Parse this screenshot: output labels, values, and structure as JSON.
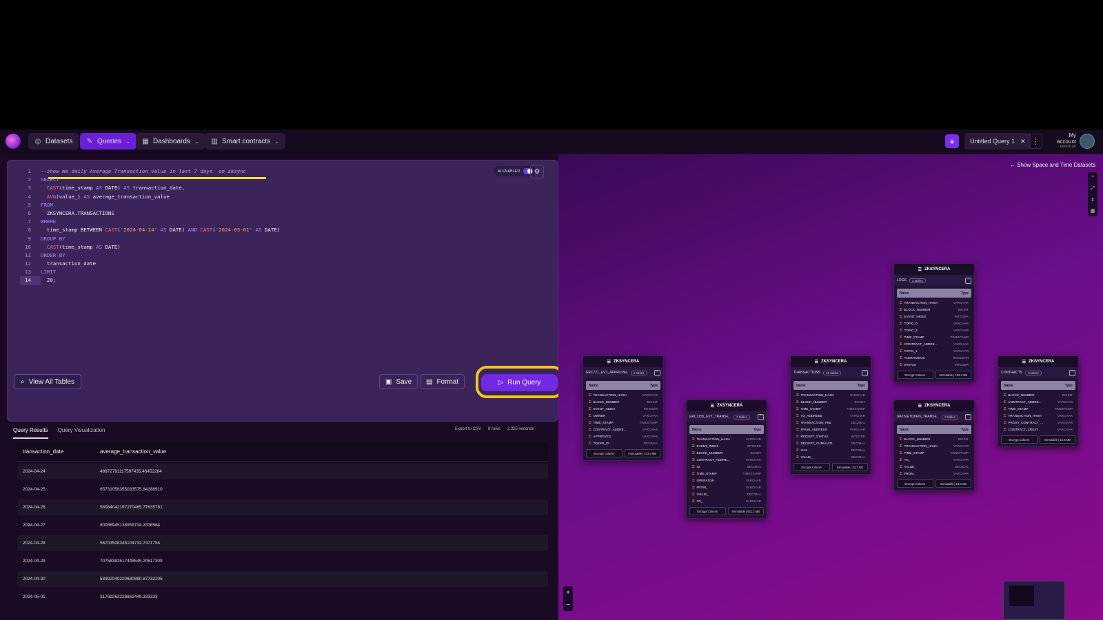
{
  "nav": {
    "datasets": "Datasets",
    "queries": "Queries",
    "dashboards": "Dashboards",
    "smart_contracts": "Smart contracts",
    "query_tab": "Untitled Query 1",
    "account_title": "My account",
    "account_sub": "qwertran"
  },
  "editor": {
    "ai_label": "AI ENABLED",
    "lines": [
      {
        "n": "1",
        "segs": [
          {
            "c": "cm",
            "t": "--show me daily Average Transaction Value in last 7 days  on zksync"
          }
        ]
      },
      {
        "n": "2",
        "segs": [
          {
            "c": "kw",
            "t": "SELECT"
          }
        ]
      },
      {
        "n": "3",
        "segs": [
          {
            "c": "tx",
            "t": "  "
          },
          {
            "c": "fn",
            "t": "CAST"
          },
          {
            "c": "tx",
            "t": "(time_stamp "
          },
          {
            "c": "kw",
            "t": "AS"
          },
          {
            "c": "tx",
            "t": " DATE) "
          },
          {
            "c": "kw",
            "t": "AS"
          },
          {
            "c": "tx",
            "t": " transaction_date,"
          }
        ]
      },
      {
        "n": "4",
        "segs": [
          {
            "c": "tx",
            "t": "  "
          },
          {
            "c": "fn",
            "t": "AVG"
          },
          {
            "c": "tx",
            "t": "(value_) "
          },
          {
            "c": "kw",
            "t": "AS"
          },
          {
            "c": "tx",
            "t": " average_transaction_value"
          }
        ]
      },
      {
        "n": "5",
        "segs": [
          {
            "c": "kw",
            "t": "FROM"
          }
        ]
      },
      {
        "n": "6",
        "segs": [
          {
            "c": "tx",
            "t": "  ZKSYNCERA.TRANSACTIONS"
          }
        ]
      },
      {
        "n": "7",
        "segs": [
          {
            "c": "kw",
            "t": "WHERE"
          }
        ]
      },
      {
        "n": "8",
        "segs": [
          {
            "c": "tx",
            "t": "  time_stamp BETWEEN "
          },
          {
            "c": "fn",
            "t": "CAST"
          },
          {
            "c": "tx",
            "t": "("
          },
          {
            "c": "str",
            "t": "'2024-04-24'"
          },
          {
            "c": "tx",
            "t": " "
          },
          {
            "c": "kw",
            "t": "AS"
          },
          {
            "c": "tx",
            "t": " DATE) "
          },
          {
            "c": "kw",
            "t": "AND"
          },
          {
            "c": "tx",
            "t": " "
          },
          {
            "c": "fn",
            "t": "CAST"
          },
          {
            "c": "tx",
            "t": "("
          },
          {
            "c": "str",
            "t": "'2024-05-01'"
          },
          {
            "c": "tx",
            "t": " "
          },
          {
            "c": "kw",
            "t": "AS"
          },
          {
            "c": "tx",
            "t": " DATE)"
          }
        ]
      },
      {
        "n": "9",
        "segs": [
          {
            "c": "kw",
            "t": "GROUP BY"
          }
        ]
      },
      {
        "n": "10",
        "segs": [
          {
            "c": "tx",
            "t": "  "
          },
          {
            "c": "fn",
            "t": "CAST"
          },
          {
            "c": "tx",
            "t": "(time_stamp "
          },
          {
            "c": "kw",
            "t": "AS"
          },
          {
            "c": "tx",
            "t": " DATE)"
          }
        ]
      },
      {
        "n": "11",
        "segs": [
          {
            "c": "kw",
            "t": "ORDER BY"
          }
        ]
      },
      {
        "n": "12",
        "segs": [
          {
            "c": "tx",
            "t": "  transaction_date"
          }
        ]
      },
      {
        "n": "13",
        "segs": [
          {
            "c": "kw",
            "t": "LIMIT"
          }
        ]
      },
      {
        "n": "14",
        "segs": [
          {
            "c": "tx",
            "t": "  20;"
          }
        ]
      }
    ],
    "view_all_tables": "View All Tables",
    "save": "Save",
    "format": "Format",
    "run_query": "Run Query"
  },
  "results": {
    "tab_results": "Query Results",
    "tab_viz": "Query Visualization",
    "export": "Export to CSV",
    "rows": "8 rows",
    "time": "2.325 seconds",
    "columns": [
      "transaction_date",
      "average_transaction_value"
    ],
    "rows_data": [
      [
        "2024-04-24",
        "48872791117597435.46452284"
      ],
      [
        "2024-04-25",
        "65731058355033575.84188910"
      ],
      [
        "2024-04-26",
        "58084042197270465.77635781"
      ],
      [
        "2024-04-27",
        "80086945138959734.2836564"
      ],
      [
        "2024-04-28",
        "56703508345104732.7471754"
      ],
      [
        "2024-04-29",
        "70758381517448545.20617309"
      ],
      [
        "2024-04-30",
        "58392040220680880.87732205"
      ],
      [
        "2024-05-01",
        "31769263228862449.333333"
      ]
    ]
  },
  "canvas": {
    "show_datasets": "Show Space and Time Datasets",
    "name_col": "Name",
    "type_col": "Type",
    "encrypt": "Encrypt Column",
    "tables": [
      {
        "db": "ZKSYNCERA",
        "name": "ERC721_EVT_APPROVAL",
        "count": "2 tables",
        "size": "Immutable | 273.3 MB",
        "cols": [
          [
            "TRANSACTION_HASH",
            "VARCHAR"
          ],
          [
            "BLOCK_NUMBER",
            "BIGINT"
          ],
          [
            "EVENT_INDEX",
            "INTEGER"
          ],
          [
            "OWNER",
            "VARCHAR"
          ],
          [
            "TIME_STAMP",
            "TIMESTAMP"
          ],
          [
            "CONTRACT_ADDRE...",
            "VARCHAR"
          ],
          [
            "APPROVED",
            "VARCHAR"
          ],
          [
            "TOKEN_ID",
            "DECIMAL"
          ]
        ]
      },
      {
        "db": "ZKSYNCERA",
        "name": "ERC1155_EVT_TRANSF...",
        "count": "2 tables",
        "size": "Immutable | 611.2 MB",
        "cols": [
          [
            "TRANSACTION_HASH",
            "VARCHAR"
          ],
          [
            "EVENT_INDEX",
            "INTEGER"
          ],
          [
            "BLOCK_NUMBER",
            "BIGINT"
          ],
          [
            "CONTRACT_ADDRE...",
            "VARCHAR"
          ],
          [
            "ID",
            "DECIMAL"
          ],
          [
            "TIME_STAMP",
            "TIMESTAMP"
          ],
          [
            "OPERATOR",
            "VARCHAR"
          ],
          [
            "FROM_",
            "VARCHAR"
          ],
          [
            "VALUE_",
            "DECIMAL"
          ],
          [
            "TO_",
            "VARCHAR"
          ]
        ]
      },
      {
        "db": "ZKSYNCERA",
        "name": "TRANSACTIONS",
        "count": "10 tables",
        "size": "Immutable | 43.7 GB",
        "cols": [
          [
            "TRANSACTION_HASH",
            "VARCHAR"
          ],
          [
            "BLOCK_NUMBER",
            "BIGINT"
          ],
          [
            "TIME_STAMP",
            "TIMESTAMP"
          ],
          [
            "TO_ADDRESS",
            "VARCHAR"
          ],
          [
            "TRANSACTION_FEE",
            "DECIMAL"
          ],
          [
            "FROM_ADDRESS",
            "VARCHAR"
          ],
          [
            "RECEIPT_STATUS",
            "INTEGER"
          ],
          [
            "RECEIPT_CUMULATI...",
            "DECIMAL"
          ],
          [
            "GAS",
            "DECIMAL"
          ],
          [
            "VALUE_",
            "DECIMAL"
          ]
        ]
      },
      {
        "db": "ZKSYNCERA",
        "name": "LOGS",
        "count": "3 tables",
        "size": "Immutable | 154.3 GB",
        "cols": [
          [
            "TRANSACTION_HASH",
            "VARCHAR"
          ],
          [
            "BLOCK_NUMBER",
            "BIGINT"
          ],
          [
            "EVENT_INDEX",
            "INTEGER"
          ],
          [
            "TOPIC_0",
            "VARCHAR"
          ],
          [
            "TOPIC_3",
            "VARCHAR"
          ],
          [
            "TIME_STAMP",
            "TIMESTAMP"
          ],
          [
            "CONTRACT_ADDRE...",
            "VARCHAR"
          ],
          [
            "TOPIC_1",
            "VARCHAR"
          ],
          [
            "ANONYMOUS",
            "BOOLEAN"
          ],
          [
            "STATUS",
            "INTEGER"
          ]
        ]
      },
      {
        "db": "ZKSYNCERA",
        "name": "NATIVETOKEN_TRANSF...",
        "count": "2 tables",
        "size": "Immutable | 14.8 GB",
        "cols": [
          [
            "BLOCK_NUMBER",
            "BIGINT"
          ],
          [
            "TRANSACTION_HASH",
            "VARCHAR"
          ],
          [
            "TIME_STAMP",
            "TIMESTAMP"
          ],
          [
            "TO_",
            "VARCHAR"
          ],
          [
            "VALUE_",
            "DECIMAL"
          ],
          [
            "FROM_",
            "VARCHAR"
          ]
        ]
      },
      {
        "db": "ZKSYNCERA",
        "name": "CONTRACTS",
        "count": "6 tables",
        "size": "Immutable | 10.6 MB",
        "cols": [
          [
            "BLOCK_NUMBER",
            "BIGINT"
          ],
          [
            "CONTRACT_ADDRE...",
            "VARCHAR"
          ],
          [
            "TIME_STAMP",
            "TIMESTAMP"
          ],
          [
            "TRANSACTION_HASH",
            "VARCHAR"
          ],
          [
            "PROXY_CONTRACT_...",
            "VARCHAR"
          ],
          [
            "CONTRACT_CREAT...",
            "VARCHAR"
          ]
        ]
      }
    ]
  }
}
